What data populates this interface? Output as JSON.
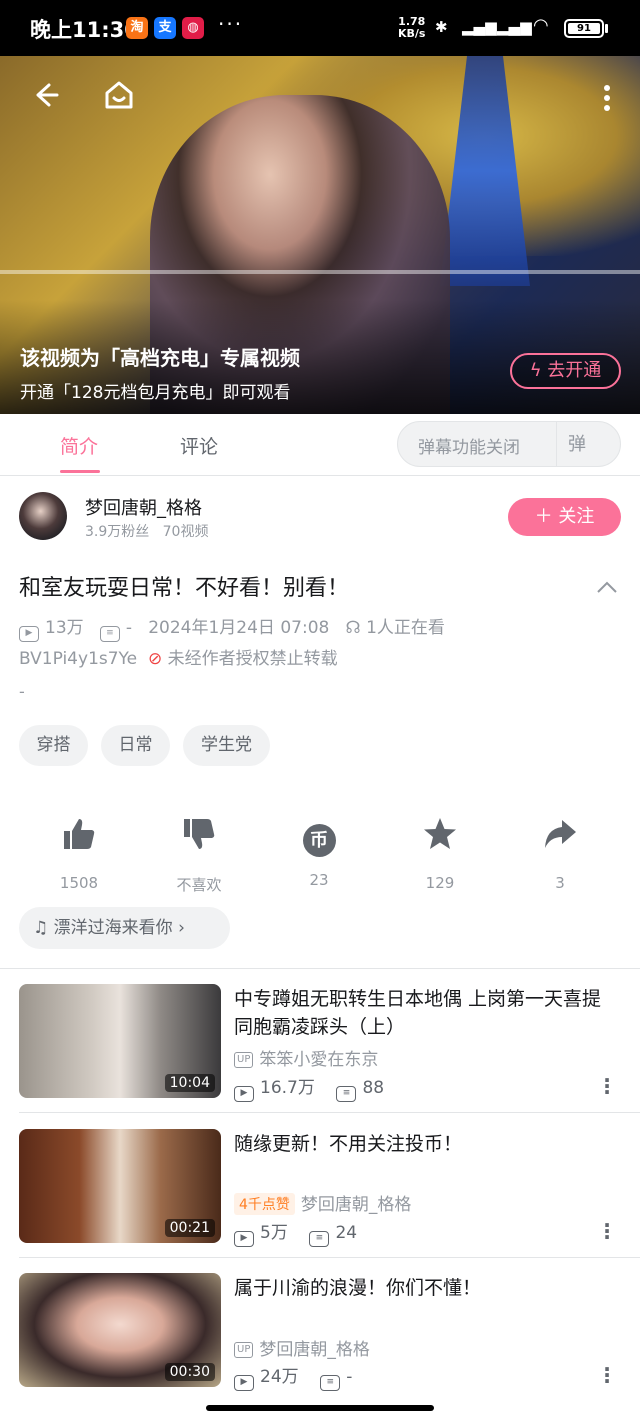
{
  "status_bar": {
    "time": "晚上11:30",
    "dots": "···",
    "speed_value": "1.78",
    "speed_unit": "KB/s",
    "battery": "91"
  },
  "video": {
    "paywall_title": "该视频为「高档充电」专属视频",
    "paywall_sub": "开通「128元档包月充电」即可观看",
    "open_button": "去开通"
  },
  "tabs": {
    "intro": "简介",
    "comments": "评论"
  },
  "danmaku": {
    "label": "弹幕功能关闭",
    "toggle": "弹"
  },
  "uploader": {
    "name": "梦回唐朝_格格",
    "fans": "3.9万粉丝",
    "videos": "70视频",
    "follow": "关注"
  },
  "detail": {
    "title": "和室友玩耍日常！不好看！别看！",
    "views": "13万",
    "danmaku_count": "-",
    "date": "2024年1月24日 07:08",
    "watching": "1人正在看",
    "bvid": "BV1Pi4y1s7Ye",
    "notice": "未经作者授权禁止转载",
    "desc": "-"
  },
  "tags": [
    "穿搭",
    "日常",
    "学生党"
  ],
  "actions": {
    "like": "1508",
    "dislike": "不喜欢",
    "coin": "23",
    "fav": "129",
    "share": "3"
  },
  "music": {
    "label": "漂洋过海来看你"
  },
  "related": [
    {
      "title": "中专蹲姐无职转生日本地偶 上岗第一天喜提同胞霸凌踩头（上）",
      "badge": "",
      "up": "笨笨小愛在东京",
      "views": "16.7万",
      "danmaku": "88",
      "duration": "10:04"
    },
    {
      "title": "随缘更新！不用关注投币！",
      "badge": "4千点赞",
      "up": "梦回唐朝_格格",
      "views": "5万",
      "danmaku": "24",
      "duration": "00:21"
    },
    {
      "title": "属于川渝的浪漫！你们不懂！",
      "badge": "",
      "up": "梦回唐朝_格格",
      "views": "24万",
      "danmaku": "-",
      "duration": "00:30"
    }
  ],
  "colors": {
    "accent": "#fb7299",
    "text": "#18191c",
    "muted": "#9499a0"
  }
}
